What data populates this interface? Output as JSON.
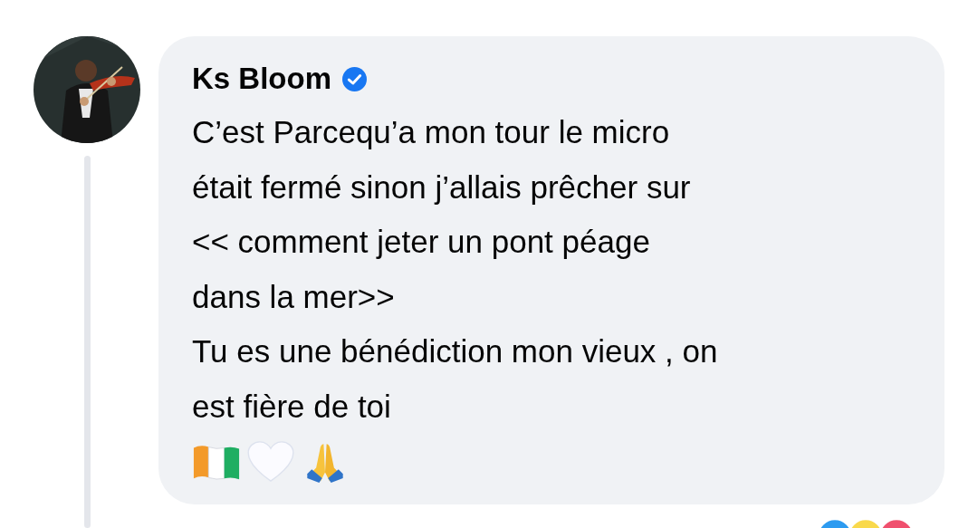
{
  "comment": {
    "author": "Ks Bloom",
    "verified": true,
    "text": "C’est Parcequ’a mon tour le micro\nétait fermé sinon j’allais prêcher sur\n<< comment jeter un pont péage\ndans la mer>>\nTu es une bénédiction mon vieux , on\nest fière de toi"
  }
}
